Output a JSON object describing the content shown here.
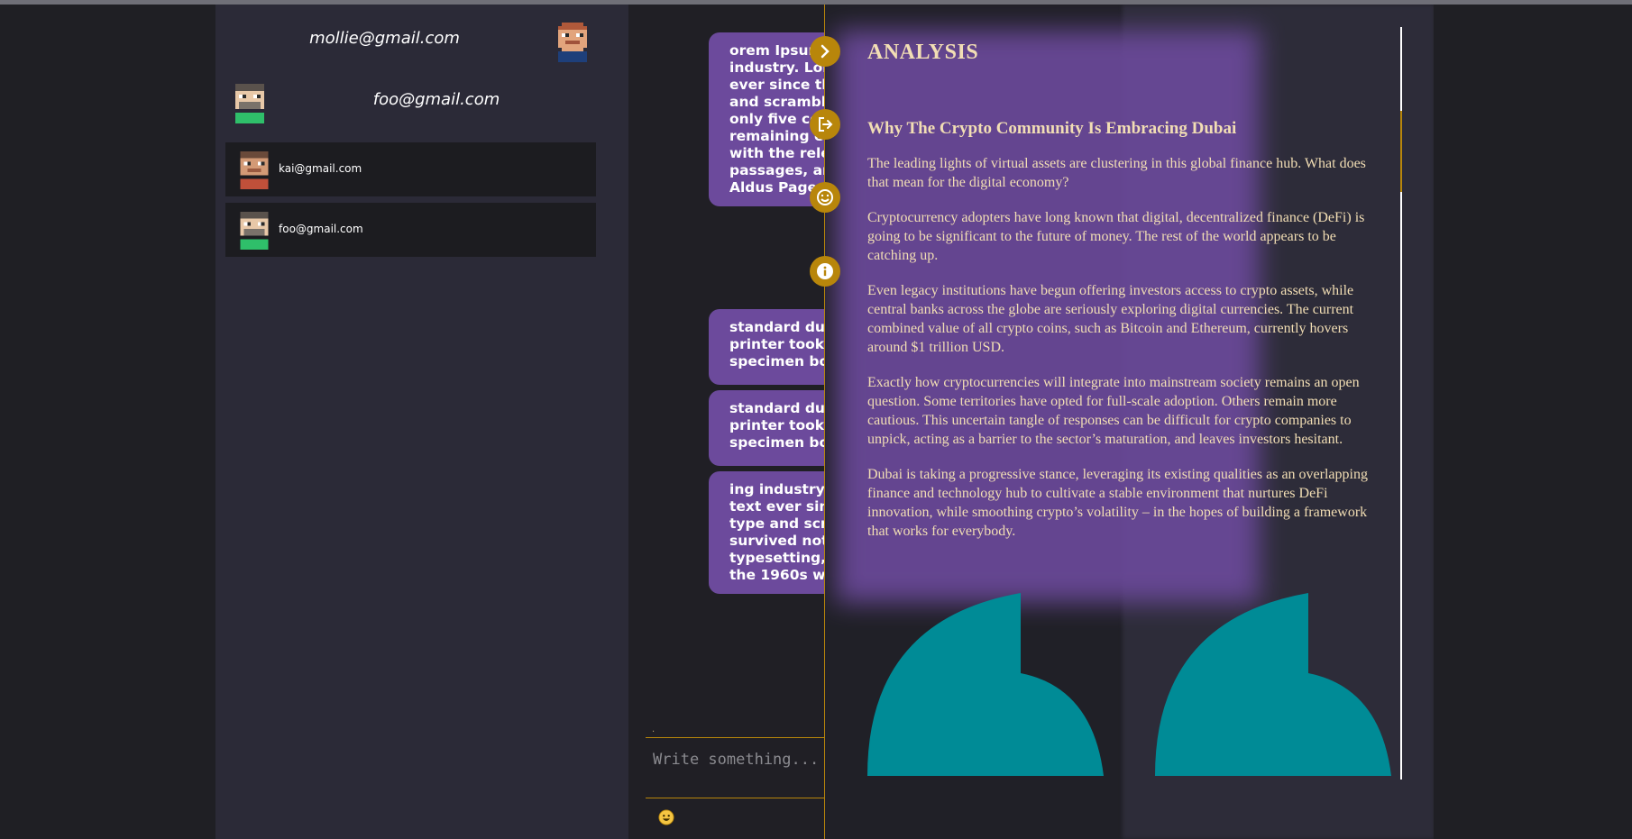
{
  "sidebar": {
    "current_user": "mollie@gmail.com",
    "active_chat_user": "foo@gmail.com",
    "contacts": [
      {
        "email": "kai@gmail.com"
      },
      {
        "email": "foo@gmail.com"
      }
    ]
  },
  "chat": {
    "messages": [
      "orem Ipsum\nindustry. Lor\never since th\nand scramble\nonly five ce\nremaining e\nwith the rele\npassages, an\nAldus Page",
      "standard dur\nprinter took \nspecimen boo",
      "standard dur\nprinter took \nspecimen boo",
      "ing industry.\ntext ever sinc\ntype and scr\nsurvived not \ntypesetting, \nthe 1960s wit"
    ],
    "composer_marker": ".",
    "composer_placeholder": "Write something..."
  },
  "panel": {
    "kicker": "ANALYSIS",
    "title": "Why The Crypto Community Is Embracing Dubai",
    "paragraphs": [
      "The leading lights of virtual assets are clustering in this global finance hub. What does that mean for the digital economy?",
      "Cryptocurrency adopters have long known that digital, decentralized finance (DeFi) is going to be significant to the future of money. The rest of the world appears to be catching up.",
      "Even legacy institutions have begun offering investors access to crypto assets, while central banks across the globe are seriously exploring digital currencies. The current combined value of all crypto coins, such as Bitcoin and Ethereum, currently hovers around $1 trillion USD.",
      "Exactly how cryptocurrencies will integrate into mainstream society remains an open question. Some territories have opted for full-scale adoption. Others remain more cautious. This uncertain tangle of responses can be difficult for crypto companies to unpick, acting as a barrier to the sector’s maturation, and leaves investors hesitant.",
      "Dubai is taking a progressive stance, leveraging its existing qualities as an overlapping finance and technology hub to cultivate a stable environment that nurtures DeFi innovation, while smoothing crypto’s volatility – in the hopes of building a framework that works for everybody."
    ]
  },
  "side_buttons": [
    {
      "icon": "chevron-right-icon"
    },
    {
      "icon": "logout-icon"
    },
    {
      "icon": "smiley-icon"
    },
    {
      "icon": "info-icon"
    }
  ],
  "colors": {
    "accent": "#b8860b",
    "bubble": "#6c4a9c",
    "quote": "#008b96",
    "panel_text": "#f2deb4"
  }
}
